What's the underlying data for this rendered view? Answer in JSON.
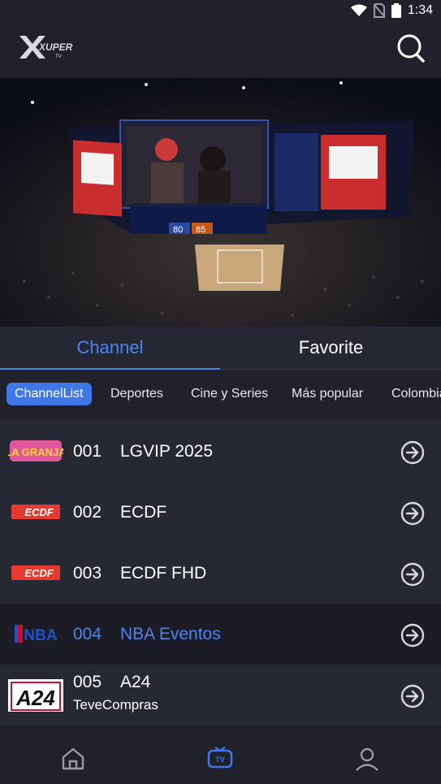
{
  "status": {
    "time": "1:34"
  },
  "app": {
    "logo_text": "XUPER",
    "logo_sub": "TV"
  },
  "hero": {
    "scoreboard": {
      "left": "80",
      "right": "85"
    }
  },
  "tabs": [
    {
      "label": "Channel",
      "active": true
    },
    {
      "label": "Favorite",
      "active": false
    }
  ],
  "chips": [
    "ChannelList",
    "Deportes",
    "Cine y Series",
    "Más popular",
    "Colombia"
  ],
  "channels": [
    {
      "num": "001",
      "name": "LGVIP 2025",
      "sub": "",
      "logo": "LA GRANJA",
      "selected": false
    },
    {
      "num": "002",
      "name": "ECDF",
      "sub": "",
      "logo": "ECDF",
      "selected": false
    },
    {
      "num": "003",
      "name": "ECDF FHD",
      "sub": "",
      "logo": "ECDF",
      "selected": false
    },
    {
      "num": "004",
      "name": "NBA Eventos",
      "sub": "",
      "logo": "NBA",
      "selected": true
    },
    {
      "num": "005",
      "name": "A24",
      "sub": "TeveCompras",
      "logo": "A24",
      "selected": false
    }
  ],
  "colors": {
    "accent": "#4f83f0",
    "bg": "#20212b",
    "row": "#262833"
  }
}
